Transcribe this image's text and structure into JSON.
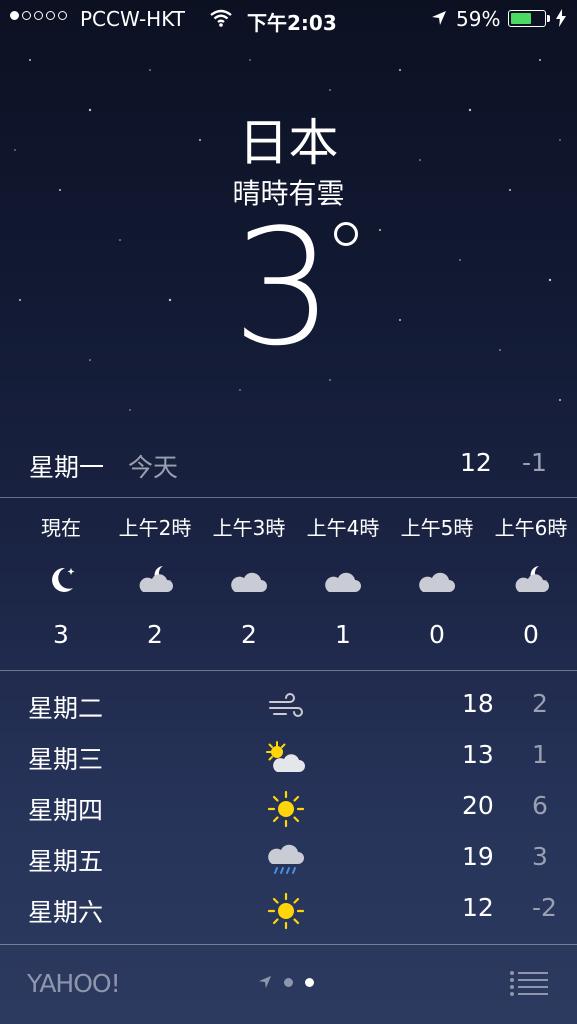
{
  "status_bar": {
    "carrier": "PCCW-HKT",
    "time": "下午2:03",
    "battery_percent": "59%",
    "battery_level": 0.59,
    "signal_bars_filled": 1,
    "signal_bars_total": 5
  },
  "location": {
    "city": "日本",
    "condition": "晴時有雲",
    "temperature": "3"
  },
  "today": {
    "day": "星期一",
    "label": "今天",
    "high": "12",
    "low": "-1"
  },
  "hourly": [
    {
      "time": "現在",
      "icon": "moon-icon",
      "temp": "3"
    },
    {
      "time": "上午2時",
      "icon": "partly-cloudy-night-icon",
      "temp": "2"
    },
    {
      "time": "上午3時",
      "icon": "cloud-icon",
      "temp": "2"
    },
    {
      "time": "上午4時",
      "icon": "cloud-icon",
      "temp": "1"
    },
    {
      "time": "上午5時",
      "icon": "cloud-icon",
      "temp": "0"
    },
    {
      "time": "上午6時",
      "icon": "partly-cloudy-night-icon",
      "temp": "0"
    }
  ],
  "daily": [
    {
      "day": "星期二",
      "icon": "wind-icon",
      "high": "18",
      "low": "2"
    },
    {
      "day": "星期三",
      "icon": "partly-sunny-icon",
      "high": "13",
      "low": "1"
    },
    {
      "day": "星期四",
      "icon": "sun-icon",
      "high": "20",
      "low": "6"
    },
    {
      "day": "星期五",
      "icon": "rain-icon",
      "high": "19",
      "low": "3"
    },
    {
      "day": "星期六",
      "icon": "sun-icon",
      "high": "12",
      "low": "-2"
    }
  ],
  "footer": {
    "brand": "YAHOO!",
    "pages": 2,
    "active_page": 2
  },
  "colors": {
    "sun": "#ffd60a",
    "cloud": "#c9ccd4",
    "battery": "#4cd964",
    "dim_text": "#9aa0b0"
  }
}
